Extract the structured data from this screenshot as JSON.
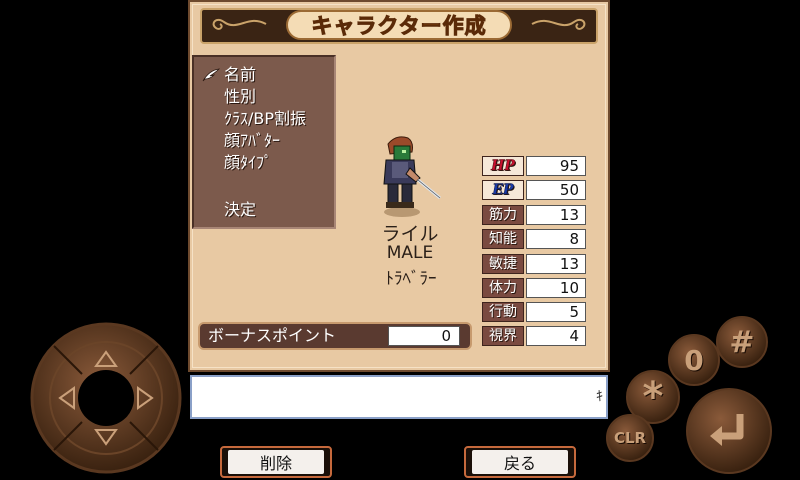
{
  "title": "キャラクター作成",
  "menu": {
    "items": [
      {
        "label": "名前"
      },
      {
        "label": "性別"
      },
      {
        "label": "ｸﾗｽ/BP割振"
      },
      {
        "label": "顔ｱﾊﾞﾀｰ"
      },
      {
        "label": "顔ﾀｲﾌﾟ"
      },
      {
        "label": "決定"
      }
    ],
    "selected_index": 0
  },
  "character": {
    "name": "ライル",
    "gender": "MALE",
    "class": "ﾄﾗﾍﾞﾗｰ"
  },
  "stats": [
    {
      "label": "HP",
      "value": "95"
    },
    {
      "label": "EP",
      "value": "50"
    },
    {
      "label": "筋力",
      "value": "13"
    },
    {
      "label": "知能",
      "value": "8"
    },
    {
      "label": "敏捷",
      "value": "13"
    },
    {
      "label": "体力",
      "value": "10"
    },
    {
      "label": "行動",
      "value": "5"
    },
    {
      "label": "視界",
      "value": "4"
    }
  ],
  "bonus": {
    "label": "ボーナスポイント",
    "value": "0"
  },
  "message": {
    "text": "",
    "end_mark": "ｷ"
  },
  "buttons": {
    "delete": "削除",
    "back": "戻る"
  },
  "controls": {
    "hash": "#",
    "zero": "0",
    "star": "*",
    "clear": "CLR",
    "enter_icon": "enter-arrow-icon"
  },
  "colors": {
    "window_bg": "#e8c9a3",
    "menu_bg": "#7c5a4c",
    "title_text": "#e07a14",
    "hp_label": "#c8102e",
    "ep_label": "#1a3aa8",
    "button_border": "#c6693c"
  }
}
